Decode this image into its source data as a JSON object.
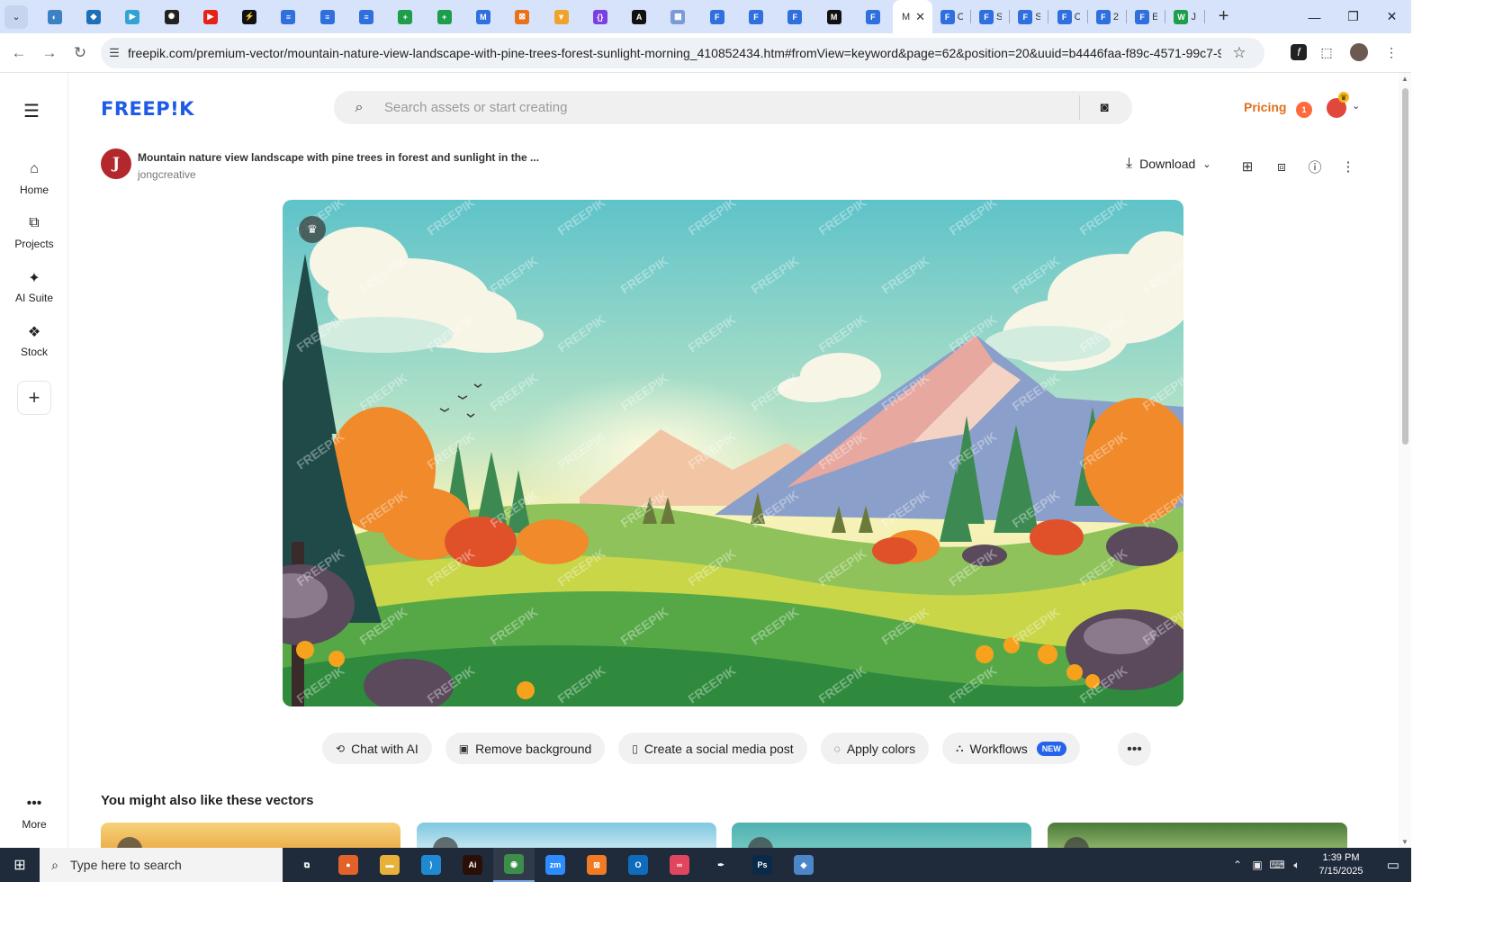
{
  "browser": {
    "tabs": [
      {
        "icon": "app-icon",
        "color": "#3b82c4",
        "glyph": "◐",
        "title": ""
      },
      {
        "icon": "app-icon",
        "color": "#1e6fb8",
        "glyph": "◆",
        "title": ""
      },
      {
        "icon": "app-icon",
        "color": "#33a3d6",
        "glyph": "▶",
        "title": ""
      },
      {
        "icon": "openai-icon",
        "color": "#222222",
        "glyph": "✺",
        "title": ""
      },
      {
        "icon": "youtube-icon",
        "color": "#e62117",
        "glyph": "▶",
        "title": ""
      },
      {
        "icon": "app-icon",
        "color": "#111111",
        "glyph": "⚡",
        "title": ""
      },
      {
        "icon": "docs-icon",
        "color": "#2f6fde",
        "glyph": "≡",
        "title": ""
      },
      {
        "icon": "docs-icon",
        "color": "#2f6fde",
        "glyph": "≡",
        "title": ""
      },
      {
        "icon": "docs-icon",
        "color": "#2f6fde",
        "glyph": "≡",
        "title": ""
      },
      {
        "icon": "sheets-icon",
        "color": "#1e9e4a",
        "glyph": "+",
        "title": ""
      },
      {
        "icon": "sheets-icon",
        "color": "#1e9e4a",
        "glyph": "+",
        "title": ""
      },
      {
        "icon": "app-icon",
        "color": "#2f6fde",
        "glyph": "M",
        "title": ""
      },
      {
        "icon": "app-icon",
        "color": "#e8711c",
        "glyph": "⊠",
        "title": ""
      },
      {
        "icon": "app-icon",
        "color": "#f0a32a",
        "glyph": "⩔",
        "title": ""
      },
      {
        "icon": "app-icon",
        "color": "#7a3fe0",
        "glyph": "{}",
        "title": ""
      },
      {
        "icon": "app-icon",
        "color": "#111111",
        "glyph": "A",
        "title": ""
      },
      {
        "icon": "app-icon",
        "color": "#7b9bd6",
        "glyph": "▦",
        "title": ""
      },
      {
        "icon": "forms-icon",
        "color": "#2f6fde",
        "glyph": "F",
        "title": ""
      },
      {
        "icon": "forms-icon",
        "color": "#2f6fde",
        "glyph": "F",
        "title": ""
      },
      {
        "icon": "forms-icon",
        "color": "#2f6fde",
        "glyph": "F",
        "title": ""
      },
      {
        "icon": "app-icon",
        "color": "#111111",
        "glyph": "M",
        "title": ""
      },
      {
        "icon": "forms-icon",
        "color": "#2f6fde",
        "glyph": "F",
        "title": ""
      }
    ],
    "active_tab": {
      "title": "M",
      "close": "✕"
    },
    "tabs_after": [
      {
        "icon": "forms-icon",
        "color": "#2f6fde",
        "glyph": "F",
        "title": "C"
      },
      {
        "icon": "forms-icon",
        "color": "#2f6fde",
        "glyph": "F",
        "title": "S"
      },
      {
        "icon": "forms-icon",
        "color": "#2f6fde",
        "glyph": "F",
        "title": "S"
      },
      {
        "icon": "forms-icon",
        "color": "#2f6fde",
        "glyph": "F",
        "title": "C"
      },
      {
        "icon": "forms-icon",
        "color": "#2f6fde",
        "glyph": "F",
        "title": "2"
      },
      {
        "icon": "forms-icon",
        "color": "#2f6fde",
        "glyph": "F",
        "title": "E"
      },
      {
        "icon": "app-icon",
        "color": "#1e9e4a",
        "glyph": "W",
        "title": "J"
      }
    ],
    "url": "freepik.com/premium-vector/mountain-nature-view-landscape-with-pine-trees-forest-sunlight-morning_410852434.htm#fromView=keyword&page=62&position=20&uuid=b4446faa-f89c-4571-99c7-9cf223d..."
  },
  "site": {
    "logo": "FREEP!K",
    "search_placeholder": "Search assets or start creating",
    "pricing": "Pricing",
    "notification_count": "1"
  },
  "sidebar": {
    "items": [
      {
        "label": "Home",
        "icon": "home-icon"
      },
      {
        "label": "Projects",
        "icon": "projects-icon"
      },
      {
        "label": "AI Suite",
        "icon": "sparkle-icon"
      },
      {
        "label": "Stock",
        "icon": "stock-icon"
      }
    ],
    "more": "More"
  },
  "asset": {
    "title": "Mountain nature view landscape with pine trees in forest and sunlight in the ...",
    "author": "jongcreative",
    "author_initial": "J",
    "download": "Download",
    "watermark": "FREEPIK"
  },
  "ai_actions": [
    {
      "label": "Chat with AI",
      "icon": "chat-icon"
    },
    {
      "label": "Remove background",
      "icon": "remove-bg-icon"
    },
    {
      "label": "Create a social media post",
      "icon": "phone-icon"
    },
    {
      "label": "Apply colors",
      "icon": "palette-icon"
    },
    {
      "label": "Workflows",
      "icon": "workflow-icon",
      "badge": "NEW"
    }
  ],
  "related": {
    "title": "You might also like these vectors"
  },
  "taskbar": {
    "search_placeholder": "Type here to search",
    "apps": [
      {
        "name": "task-view",
        "color": "#1f2a3a",
        "glyph": "⧉"
      },
      {
        "name": "firefox",
        "color": "#e2622a",
        "glyph": "●"
      },
      {
        "name": "file-explorer",
        "color": "#e8b23a",
        "glyph": "▬"
      },
      {
        "name": "vscode",
        "color": "#1f8ad2",
        "glyph": "⟩"
      },
      {
        "name": "illustrator",
        "color": "#2b0f06",
        "glyph": "Ai"
      },
      {
        "name": "chrome",
        "color": "#3d8e4a",
        "glyph": "◉"
      },
      {
        "name": "zoom",
        "color": "#2d8cff",
        "glyph": "zm"
      },
      {
        "name": "xampp",
        "color": "#f27a22",
        "glyph": "⊠"
      },
      {
        "name": "outlook",
        "color": "#0f6cbd",
        "glyph": "O"
      },
      {
        "name": "creative-cloud",
        "color": "#e2455e",
        "glyph": "∞"
      },
      {
        "name": "pen-tool",
        "color": "#1f2a3a",
        "glyph": "✒"
      },
      {
        "name": "photoshop",
        "color": "#0a2a4a",
        "glyph": "Ps"
      },
      {
        "name": "app",
        "color": "#4a86c8",
        "glyph": "◆"
      }
    ],
    "time": "1:39 PM",
    "date": "7/15/2025"
  }
}
